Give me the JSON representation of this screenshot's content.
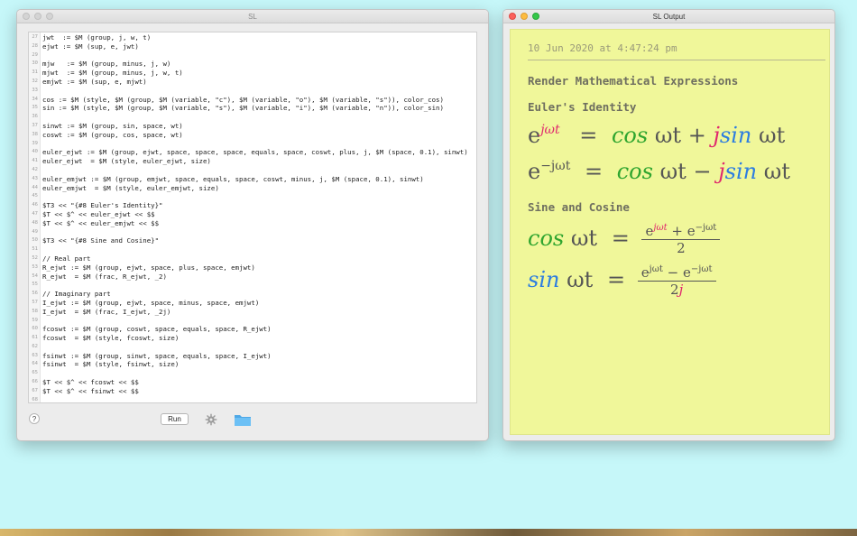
{
  "editor": {
    "title": "SL",
    "run_label": "Run",
    "help_label": "?",
    "lines": [
      {
        "n": "27",
        "text": "jwt  := $M (group, j, w, t)"
      },
      {
        "n": "28",
        "text": "ejwt := $M (sup, e, jwt)"
      },
      {
        "n": "29",
        "text": ""
      },
      {
        "n": "30",
        "text": "mjw   := $M (group, minus, j, w)"
      },
      {
        "n": "31",
        "text": "mjwt  := $M (group, minus, j, w, t)"
      },
      {
        "n": "32",
        "text": "emjwt := $M (sup, e, mjwt)"
      },
      {
        "n": "33",
        "text": ""
      },
      {
        "n": "34",
        "text": "cos := $M (style, $M (group, $M (variable, \"c\"), $M (variable, \"o\"), $M (variable, \"s\")), color_cos)"
      },
      {
        "n": "35",
        "text": "sin := $M (style, $M (group, $M (variable, \"s\"), $M (variable, \"i\"), $M (variable, \"n\")), color_sin)"
      },
      {
        "n": "36",
        "text": ""
      },
      {
        "n": "37",
        "text": "sinwt := $M (group, sin, space, wt)"
      },
      {
        "n": "38",
        "text": "coswt := $M (group, cos, space, wt)"
      },
      {
        "n": "39",
        "text": ""
      },
      {
        "n": "40",
        "text": "euler_ejwt := $M (group, ejwt, space, space, space, equals, space, coswt, plus, j, $M (space, 0.1), sinwt)"
      },
      {
        "n": "41",
        "text": "euler_ejwt  = $M (style, euler_ejwt, size)"
      },
      {
        "n": "42",
        "text": ""
      },
      {
        "n": "43",
        "text": "euler_emjwt := $M (group, emjwt, space, equals, space, coswt, minus, j, $M (space, 0.1), sinwt)"
      },
      {
        "n": "44",
        "text": "euler_emjwt  = $M (style, euler_emjwt, size)"
      },
      {
        "n": "45",
        "text": ""
      },
      {
        "n": "46",
        "text": "$T3 << \"{#8 Euler's Identity}\""
      },
      {
        "n": "47",
        "text": "$T << $^ << euler_ejwt << $$"
      },
      {
        "n": "48",
        "text": "$T << $^ << euler_emjwt << $$"
      },
      {
        "n": "49",
        "text": ""
      },
      {
        "n": "50",
        "text": "$T3 << \"{#8 Sine and Cosine}\""
      },
      {
        "n": "51",
        "text": ""
      },
      {
        "n": "52",
        "text": "// Real part"
      },
      {
        "n": "53",
        "text": "R_ejwt := $M (group, ejwt, space, plus, space, emjwt)"
      },
      {
        "n": "54",
        "text": "R_ejwt  = $M (frac, R_ejwt, _2)"
      },
      {
        "n": "55",
        "text": ""
      },
      {
        "n": "56",
        "text": "// Imaginary part"
      },
      {
        "n": "57",
        "text": "I_ejwt := $M (group, ejwt, space, minus, space, emjwt)"
      },
      {
        "n": "58",
        "text": "I_ejwt  = $M (frac, I_ejwt, _2j)"
      },
      {
        "n": "59",
        "text": ""
      },
      {
        "n": "60",
        "text": "fcoswt := $M (group, coswt, space, equals, space, R_ejwt)"
      },
      {
        "n": "61",
        "text": "fcoswt  = $M (style, fcoswt, size)"
      },
      {
        "n": "62",
        "text": ""
      },
      {
        "n": "63",
        "text": "fsinwt := $M (group, sinwt, space, equals, space, I_ejwt)"
      },
      {
        "n": "64",
        "text": "fsinwt  = $M (style, fsinwt, size)"
      },
      {
        "n": "65",
        "text": ""
      },
      {
        "n": "66",
        "text": "$T << $^ << fcoswt << $$"
      },
      {
        "n": "67",
        "text": "$T << $^ << fsinwt << $$"
      },
      {
        "n": "68",
        "text": ""
      }
    ]
  },
  "output": {
    "title": "SL Output",
    "timestamp": "10 Jun 2020 at 4:47:24 pm",
    "heading_main": "Render Mathematical Expressions",
    "heading_euler": "Euler's Identity",
    "heading_sine": "Sine and Cosine",
    "eq1": {
      "base": "e",
      "exp": "jωt",
      "eq": "=",
      "cos": "cos",
      "wt": "ωt",
      "op": "+",
      "j": "j",
      "sin": "sin",
      "wt2": "ωt"
    },
    "eq2": {
      "base": "e",
      "exp": "−jωt",
      "eq": "=",
      "cos": "cos",
      "wt": "ωt",
      "op": "−",
      "j": "j",
      "sin": "sin",
      "wt2": "ωt"
    },
    "eq3": {
      "fn": "cos",
      "wt": "ωt",
      "eq": "=",
      "num_a": "e",
      "num_a_exp": "jωt",
      "num_op": "+",
      "num_b": "e",
      "num_b_exp": "−jωt",
      "den": "2"
    },
    "eq4": {
      "fn": "sin",
      "wt": "ωt",
      "eq": "=",
      "num_a": "e",
      "num_a_exp": "jωt",
      "num_op": "−",
      "num_b": "e",
      "num_b_exp": "−jωt",
      "den": "2",
      "den_j": "j"
    }
  },
  "colors": {
    "desktop": "#c6f7f9",
    "output_bg": "#f0f79a",
    "cos": "#2fa52f",
    "sin": "#2d7de0",
    "j": "#e0286e"
  }
}
